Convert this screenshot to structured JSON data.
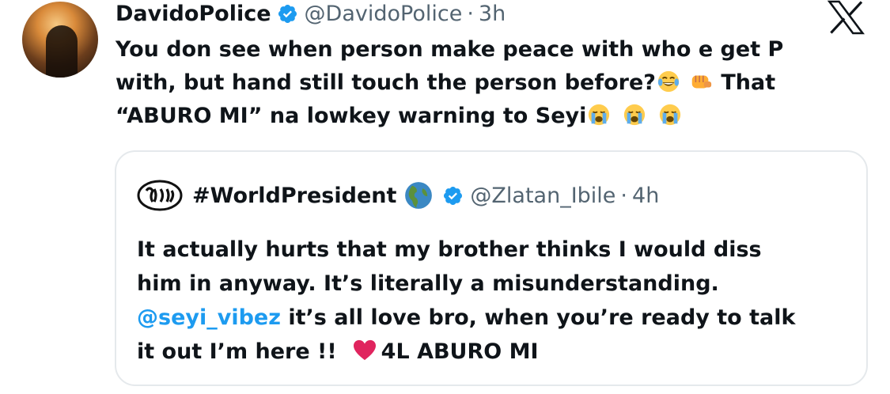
{
  "tweet": {
    "display_name": "DavidoPolice",
    "handle": "@DavidoPolice",
    "separator": "·",
    "time": "3h",
    "text_line1": "You don see when person make peace with who e get P",
    "text_line2a": "with, but hand still touch the person before?",
    "text_line2b": "That",
    "text_line3": "“ABURO MI” na lowkey warning to Seyi",
    "emojis": [
      "face-with-tears-of-joy",
      "oncoming-fist",
      "loudly-crying-face",
      "loudly-crying-face",
      "loudly-crying-face"
    ]
  },
  "quote": {
    "display_name": "#WorldPresident",
    "handle": "@Zlatan_Ibile",
    "separator": "·",
    "time": "4h",
    "line1": "It actually hurts that my brother thinks I would diss",
    "line2": "him in anyway. It’s literally a misunderstanding.",
    "mention": "@seyi_vibez",
    "line3_rest": " it’s all love bro, when you’re ready to talk",
    "line4a": "it out I’m here !!",
    "line4b": "4L ABURO MI"
  },
  "colors": {
    "text": "#0f1419",
    "secondary": "#536471",
    "accent": "#1d9bf0",
    "border": "#e5e9ec",
    "heart": "#e0245e"
  }
}
